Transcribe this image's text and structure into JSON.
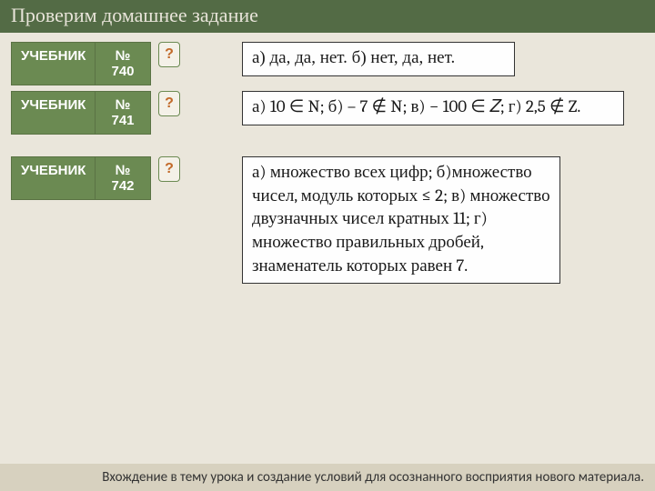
{
  "header": {
    "title": "Проверим домашнее задание"
  },
  "rows": [
    {
      "label": "УЧЕБНИК",
      "num": "№ 740",
      "q": "?",
      "answer": "а) да, да, нет. б) нет, да, нет."
    },
    {
      "label": "УЧЕБНИК",
      "num": "№ 741",
      "q": "?",
      "answer": "а) 10 ∈ N; б) – 7 ∉ N; в)  − 100 ∈ 𝑍; г) 2,5 ∉ Z."
    },
    {
      "label": "УЧЕБНИК",
      "num": "№ 742",
      "q": "?",
      "answer": "а) множество всех цифр; б)множество чисел, модуль которых ≤ 2;\nв) множество двузначных чисел кратных 11;\nг) множество правильных дробей, знаменатель которых равен 7."
    }
  ],
  "footer": {
    "text": "Вхождение в тему урока и создание условий для осознанного восприятия нового материала."
  }
}
